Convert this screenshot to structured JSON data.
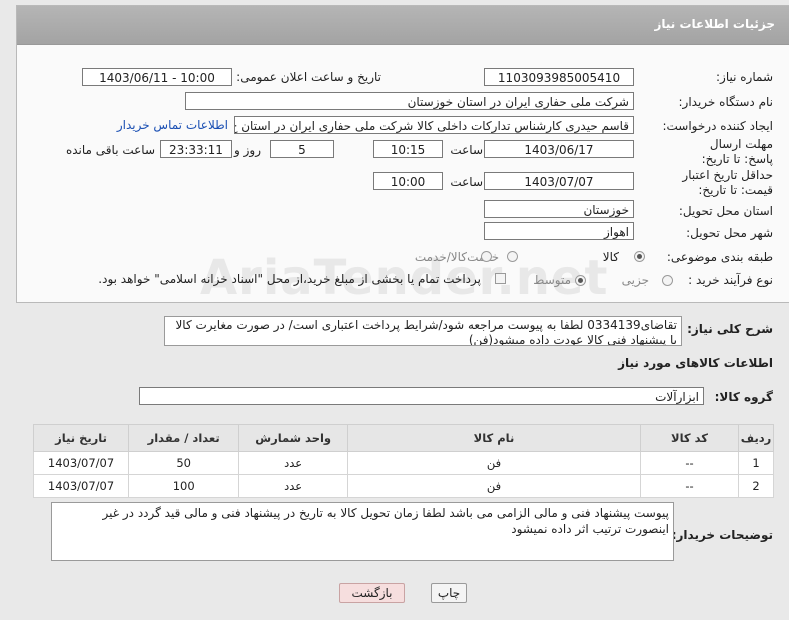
{
  "panel_title": "جزئیات اطلاعات نیاز",
  "fields": {
    "need_number_label": "شماره نیاز:",
    "need_number": "1103093985005410",
    "announce_label": "تاریخ و ساعت اعلان عمومی:",
    "announce_value": "1403/06/11 - 10:00",
    "buyer_label": "نام دستگاه خریدار:",
    "buyer_value": "شرکت ملی حفاری ایران در استان خوزستان",
    "creator_label": "ایجاد کننده درخواست:",
    "creator_value": "قاسم حیدری کارشناس تدارکات داخلی کالا شرکت ملی حفاری ایران در استان خ",
    "contact_link": "اطلاعات تماس خریدار",
    "deadline_label": "مهلت ارسال پاسخ: تا تاریخ:",
    "deadline_date": "1403/06/17",
    "time_label": "ساعت",
    "deadline_time": "10:15",
    "days_value": "5",
    "days_label": "روز و",
    "remaining_time": "23:33:11",
    "remaining_label": "ساعت باقی مانده",
    "price_validity_label": "حداقل تاریخ اعتبار قیمت: تا تاریخ:",
    "price_validity_date": "1403/07/07",
    "price_validity_time": "10:00",
    "province_label": "استان محل تحویل:",
    "province_value": "خوزستان",
    "city_label": "شهر محل تحویل:",
    "city_value": "اهواز",
    "category_label": "طبقه بندی موضوعی:",
    "category_options": [
      "کالا",
      "خدمت",
      "کالا/خدمت"
    ],
    "category_selected": "کالا",
    "process_label": "نوع فرآیند خرید :",
    "process_options": [
      "جزیی",
      "متوسط"
    ],
    "process_selected": "متوسط",
    "payment_note": "پرداخت تمام یا بخشی از مبلغ خرید،از محل \"اسناد خزانه اسلامی\" خواهد بود."
  },
  "description": {
    "label": "شرح کلی نیاز:",
    "text": "تقاضای0334139 لطفا به پیوست مراجعه شود/شرایط پرداخت اعتباری است/ در صورت مغایرت کالا با پیشنهاد فنی کالا عودت داده میشود(فن)"
  },
  "goods_section": {
    "title": "اطلاعات کالاهای مورد نیاز",
    "group_label": "گروه کالا:",
    "group_value": "ابزارآلات"
  },
  "table": {
    "headers": [
      "ردیف",
      "کد کالا",
      "نام کالا",
      "واحد شمارش",
      "تعداد / مقدار",
      "تاریخ نیاز"
    ],
    "rows": [
      [
        "1",
        "--",
        "فن",
        "عدد",
        "50",
        "1403/07/07"
      ],
      [
        "2",
        "--",
        "فن",
        "عدد",
        "100",
        "1403/07/07"
      ]
    ]
  },
  "buyer_notes": {
    "label": "توضیحات خریدار:",
    "text": "پیوست پیشنهاد فنی و مالی الزامی می باشد لطفا زمان تحویل کالا به تاریخ در پیشنهاد فنی و مالی قید گردد در غیر اینصورت ترتیب اثر داده نمیشود"
  },
  "buttons": {
    "print": "چاپ",
    "back": "بازگشت"
  },
  "watermark": "AriaTender.net"
}
